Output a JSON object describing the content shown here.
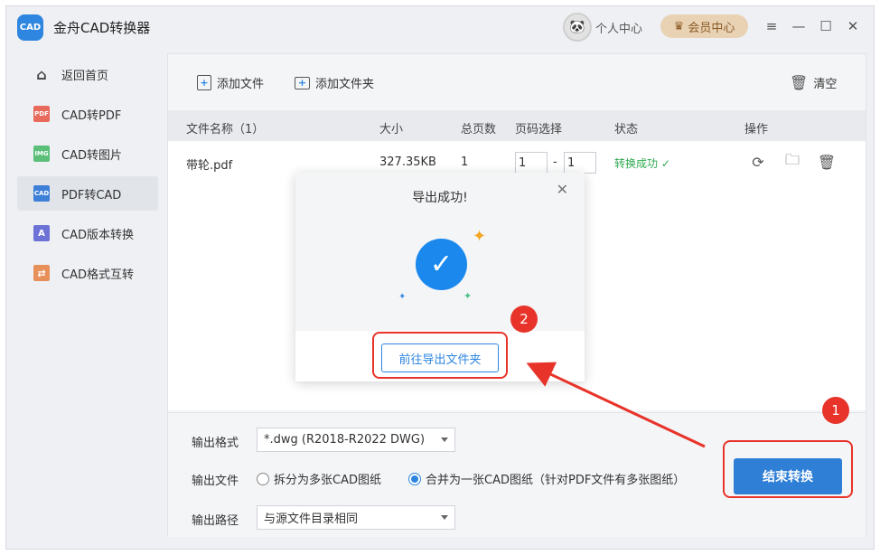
{
  "app": {
    "logo_text": "CAD",
    "title": "金舟CAD转换器",
    "user_center": "个人中心",
    "vip_label": "会员中心",
    "brand_color": "#2f86e0"
  },
  "window_controls": {
    "menu_icon": "≡",
    "minimize_icon": "—",
    "maximize_icon": "☐",
    "close_icon": "✕"
  },
  "sidebar": {
    "items": [
      {
        "label": "返回首页",
        "icon_text": "⌂"
      },
      {
        "label": "CAD转PDF",
        "icon_text": "PDF"
      },
      {
        "label": "CAD转图片",
        "icon_text": "IMG"
      },
      {
        "label": "PDF转CAD",
        "icon_text": "CAD"
      },
      {
        "label": "CAD版本转换",
        "icon_text": "A"
      },
      {
        "label": "CAD格式互转",
        "icon_text": "⇄"
      }
    ]
  },
  "toolbar": {
    "add_file": "添加文件",
    "add_folder": "添加文件夹",
    "clear": "清空"
  },
  "table": {
    "headers": {
      "name": "文件名称（1）",
      "size": "大小",
      "pages": "总页数",
      "page_select": "页码选择",
      "status": "状态",
      "actions": "操作"
    },
    "rows": [
      {
        "name": "带轮.pdf",
        "size": "327.35KB",
        "pages": "1",
        "page_from": "1",
        "page_sep": "-",
        "page_to": "1",
        "status": "转换成功 ✓"
      }
    ]
  },
  "settings": {
    "format_label": "输出格式",
    "format_value": "*.dwg (R2018-R2022 DWG)",
    "file_label": "输出文件",
    "option_split": "拆分为多张CAD图纸",
    "option_merge": "合并为一张CAD图纸（针对PDF文件有多张图纸）",
    "path_label": "输出路径",
    "path_value": "与源文件目录相同",
    "start_button": "结束转换"
  },
  "modal": {
    "title": "导出成功!",
    "close_icon": "✕",
    "check_icon": "✓",
    "open_folder_button": "前往导出文件夹"
  },
  "annotations": {
    "step1": "1",
    "step2": "2",
    "color": "#e8332a"
  }
}
